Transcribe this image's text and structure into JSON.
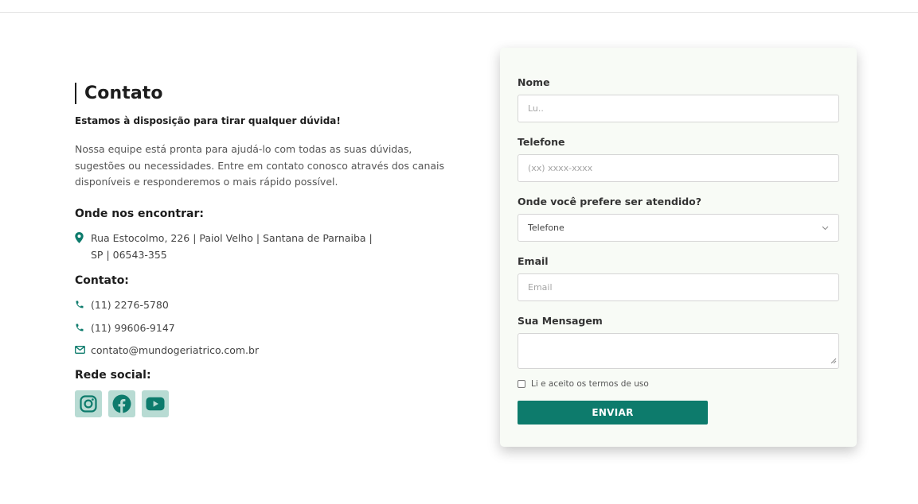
{
  "contact": {
    "title": "Contato",
    "subtitle": "Estamos à disposição para tirar qualquer dúvida!",
    "description": "Nossa equipe está pronta para ajudá-lo com todas as suas dúvidas, sugestões ou necessidades. Entre em contato conosco através dos canais disponíveis e responderemos o mais rápido possível.",
    "find_heading": "Onde nos encontrar:",
    "address": "Rua Estocolmo, 226 | Paiol Velho | Santana de Parnaiba | SP | 06543-355",
    "contact_heading": "Contato:",
    "phone1": "(11) 2276-5780",
    "phone2": "(11) 99606-9147",
    "email": "contato@mundogeriatrico.com.br",
    "social_heading": "Rede social:",
    "socials": [
      "instagram-icon",
      "facebook-icon",
      "youtube-icon"
    ]
  },
  "form": {
    "name_label": "Nome",
    "name_value": "Lu..",
    "phone_label": "Telefone",
    "phone_placeholder": "(xx) xxxx-xxxx",
    "preference_label": "Onde você prefere ser atendido?",
    "preference_value": "Telefone",
    "email_label": "Email",
    "email_placeholder": "Email",
    "message_label": "Sua Mensagem",
    "message_value": "",
    "terms_label": "Li e aceito os termos de uso",
    "submit_label": "ENVIAR"
  },
  "colors": {
    "accent": "#0d7b6c",
    "social_bg": "#b8dbd3",
    "card_bg": "#f8fbf6"
  }
}
